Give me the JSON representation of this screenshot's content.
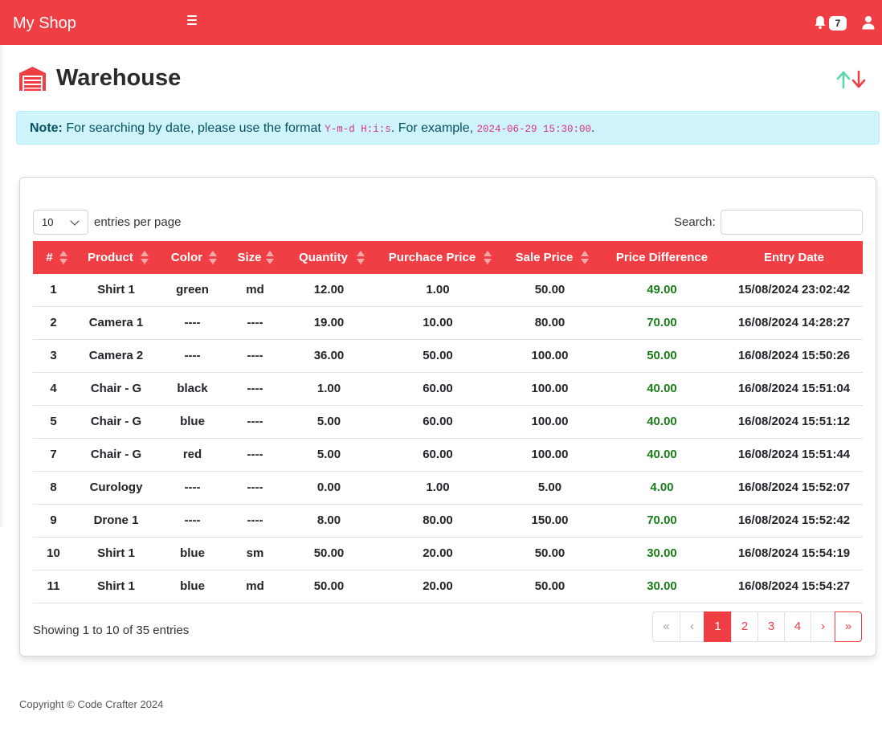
{
  "topbar": {
    "brand": "My Shop",
    "notification_count": "7",
    "color": "#ef3f44"
  },
  "page": {
    "title": "Warehouse"
  },
  "note": {
    "label": "Note:",
    "text_1": " For searching by date, please use the format ",
    "format": "Y-m-d H:i:s",
    "text_2": ". For example, ",
    "example": "2024-06-29 15:30:00",
    "text_3": "."
  },
  "table_controls": {
    "page_length": "10",
    "page_length_label": "entries per page",
    "search_label": "Search:"
  },
  "table": {
    "columns": [
      "#",
      "Product",
      "Color",
      "Size",
      "Quantity",
      "Purchace Price",
      "Sale Price",
      "Price Difference",
      "Entry Date"
    ],
    "rows": [
      [
        "1",
        "Shirt 1",
        "green",
        "md",
        "12.00",
        "1.00",
        "50.00",
        "49.00",
        "15/08/2024 23:02:42"
      ],
      [
        "2",
        "Camera 1",
        "----",
        "----",
        "19.00",
        "10.00",
        "80.00",
        "70.00",
        "16/08/2024 14:28:27"
      ],
      [
        "3",
        "Camera 2",
        "----",
        "----",
        "36.00",
        "50.00",
        "100.00",
        "50.00",
        "16/08/2024 15:50:26"
      ],
      [
        "4",
        "Chair - G",
        "black",
        "----",
        "1.00",
        "60.00",
        "100.00",
        "40.00",
        "16/08/2024 15:51:04"
      ],
      [
        "5",
        "Chair - G",
        "blue",
        "----",
        "5.00",
        "60.00",
        "100.00",
        "40.00",
        "16/08/2024 15:51:12"
      ],
      [
        "7",
        "Chair - G",
        "red",
        "----",
        "5.00",
        "60.00",
        "100.00",
        "40.00",
        "16/08/2024 15:51:44"
      ],
      [
        "8",
        "Curology",
        "----",
        "----",
        "0.00",
        "1.00",
        "5.00",
        "4.00",
        "16/08/2024 15:52:07"
      ],
      [
        "9",
        "Drone 1",
        "----",
        "----",
        "8.00",
        "80.00",
        "150.00",
        "70.00",
        "16/08/2024 15:52:42"
      ],
      [
        "10",
        "Shirt 1",
        "blue",
        "sm",
        "50.00",
        "20.00",
        "50.00",
        "30.00",
        "16/08/2024 15:54:19"
      ],
      [
        "11",
        "Shirt 1",
        "blue",
        "md",
        "50.00",
        "20.00",
        "50.00",
        "30.00",
        "16/08/2024 15:54:27"
      ]
    ],
    "diff_color": "#1a7d1a"
  },
  "info": "Showing 1 to 10 of 35 entries",
  "pagination": {
    "first": "«",
    "prev": "‹",
    "pages": [
      "1",
      "2",
      "3",
      "4"
    ],
    "next": "›",
    "last": "»",
    "current": "1"
  },
  "footer": "Copyright © Code Crafter 2024"
}
